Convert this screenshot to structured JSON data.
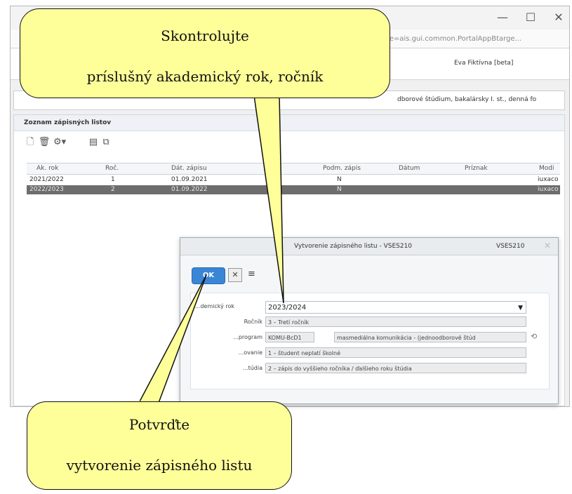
{
  "window": {
    "url_fragment": "me=ais.gui.common.PortalAppBtarge...",
    "minimize": "—",
    "maximize": "☐",
    "close": "✕"
  },
  "header": {
    "user": "Eva Fiktívna [beta]",
    "study_program": "dborové štúdium, bakalársky I. st., denná fo"
  },
  "panel": {
    "title": "Zoznam zápisných listov",
    "columns": [
      "Ak. rok",
      "Roč.",
      "Dát. zápisu",
      "Podm. zápis",
      "Dátum",
      "Príznak",
      "Modi"
    ],
    "rows": [
      {
        "year": "2021/2022",
        "rocnik": "1",
        "datum_zapisu": "01.09.2021",
        "podm": "N",
        "modi": "iuxaco"
      },
      {
        "year": "2022/2023",
        "rocnik": "2",
        "datum_zapisu": "01.09.2022",
        "podm": "N",
        "modi": "iuxaco"
      }
    ],
    "selected_row": 1
  },
  "dialog": {
    "title": "Vytvorenie zápisného listu - VSES210",
    "code": "VSES210",
    "ok_label": "OK",
    "cancel_glyph": "✕",
    "fields": {
      "rok_label": "...demický rok",
      "rok_value": "2023/2024",
      "rocnik_label": "Ročník",
      "rocnik_value": "3 – Tretí ročník",
      "program_label": "...program",
      "program_code": "KOMU-BcD1",
      "program_name": "masmediálna komunikácia - (jednoodborové štúd",
      "financovanie_label": "...ovanie",
      "financovanie_value": "1 – študent neplatí školné",
      "typ_label": "...túdia",
      "typ_value": "2 – zápis do vyššieho ročníka / ďalšieho roku štúdia"
    }
  },
  "callouts": {
    "top_line1": "Skontrolujte",
    "top_line2": "príslušný akademický rok, ročník",
    "bottom_line1": "Potvrďte",
    "bottom_line2": "vytvorenie zápisného listu"
  },
  "colors": {
    "callout_fill": "#ffff99",
    "ok_button": "#3a86d6",
    "selected_row": "#6d6d6d"
  }
}
